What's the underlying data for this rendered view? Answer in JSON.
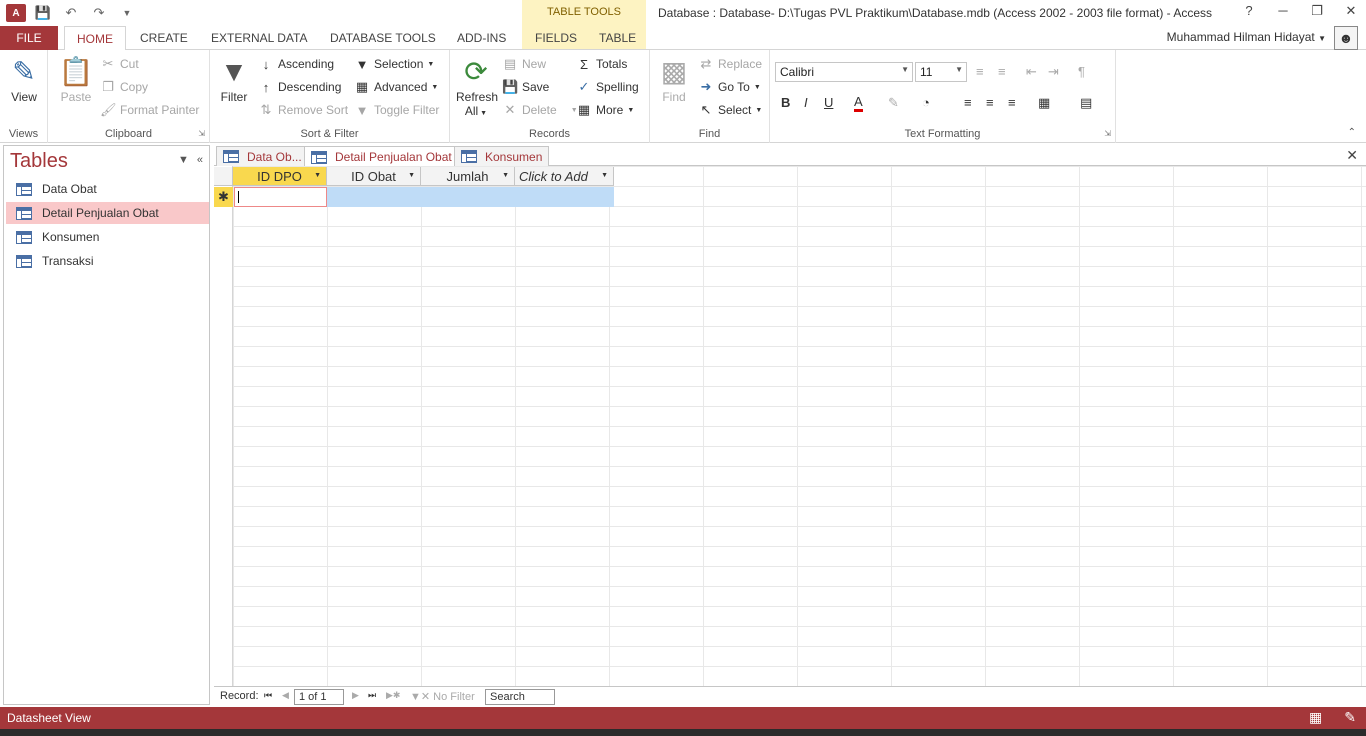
{
  "window": {
    "title": "Database : Database- D:\\Tugas PVL Praktikum\\Database.mdb (Access 2002 - 2003 file format) - Access",
    "context_group": "TABLE TOOLS",
    "user": "Muhammad Hilman Hidayat",
    "help": "?",
    "minimize": "─",
    "restore": "❐",
    "close": "✕"
  },
  "ribbon_tabs": {
    "file": "FILE",
    "home": "HOME",
    "create": "CREATE",
    "external": "EXTERNAL DATA",
    "dbtools": "DATABASE TOOLS",
    "addins": "ADD-INS",
    "fields": "FIELDS",
    "table": "TABLE"
  },
  "views": {
    "view": "View",
    "label": "Views"
  },
  "clipboard": {
    "paste": "Paste",
    "cut": "Cut",
    "copy": "Copy",
    "format_painter": "Format Painter",
    "label": "Clipboard"
  },
  "sort_filter": {
    "filter": "Filter",
    "ascending": "Ascending",
    "descending": "Descending",
    "remove_sort": "Remove Sort",
    "selection": "Selection",
    "advanced": "Advanced",
    "toggle_filter": "Toggle Filter",
    "label": "Sort & Filter"
  },
  "records": {
    "refresh": "Refresh",
    "refresh_all": "All",
    "new": "New",
    "save": "Save",
    "delete": "Delete",
    "totals": "Totals",
    "spelling": "Spelling",
    "more": "More",
    "label": "Records"
  },
  "find": {
    "find": "Find",
    "replace": "Replace",
    "goto": "Go To",
    "select": "Select",
    "label": "Find"
  },
  "text_formatting": {
    "font": "Calibri",
    "size": "11",
    "bold": "B",
    "italic": "I",
    "underline": "U",
    "label": "Text Formatting"
  },
  "nav": {
    "title": "Tables",
    "items": [
      {
        "label": "Data Obat"
      },
      {
        "label": "Detail Penjualan Obat"
      },
      {
        "label": "Konsumen"
      },
      {
        "label": "Transaksi"
      }
    ]
  },
  "doc_tabs": [
    {
      "label": "Data Ob..."
    },
    {
      "label": "Detail Penjualan Obat"
    },
    {
      "label": "Konsumen"
    }
  ],
  "datasheet": {
    "columns": [
      "ID DPO",
      "ID Obat",
      "Jumlah",
      "Click to Add"
    ],
    "new_row_marker": "✱"
  },
  "record_nav": {
    "label": "Record:",
    "position": "1 of 1",
    "no_filter": "No Filter",
    "search": "Search"
  },
  "status": {
    "text": "Datasheet View"
  }
}
